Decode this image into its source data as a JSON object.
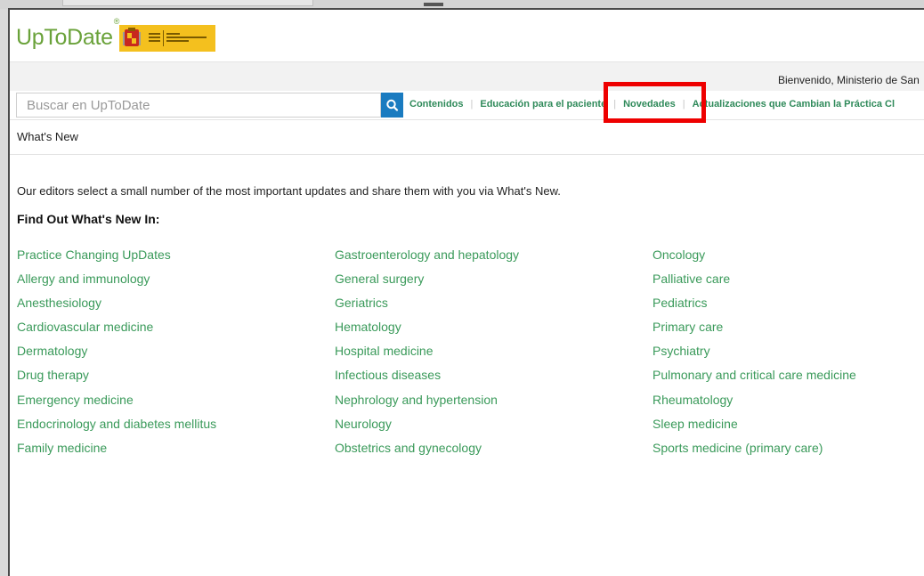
{
  "brand": {
    "logo_text": "UpToDate",
    "registered": "®"
  },
  "header": {
    "welcome": "Bienvenido, Ministerio de San"
  },
  "search": {
    "placeholder": "Buscar en UpToDate",
    "value": ""
  },
  "nav": {
    "items": [
      {
        "label": "Contenidos"
      },
      {
        "label": "Educación para el paciente"
      },
      {
        "label": "Novedades"
      },
      {
        "label": "Actualizaciones que Cambian la Práctica Cl"
      }
    ]
  },
  "breadcrumb": "What's New",
  "content": {
    "intro": "Our editors select a small number of the most important updates and share them with you via What's New.",
    "heading": "Find Out What's New In:",
    "columns": [
      [
        "Practice Changing UpDates",
        "Allergy and immunology",
        "Anesthesiology",
        "Cardiovascular medicine",
        "Dermatology",
        "Drug therapy",
        "Emergency medicine",
        "Endocrinology and diabetes mellitus",
        "Family medicine"
      ],
      [
        "Gastroenterology and hepatology",
        "General surgery",
        "Geriatrics",
        "Hematology",
        "Hospital medicine",
        "Infectious diseases",
        "Nephrology and hypertension",
        "Neurology",
        "Obstetrics and gynecology"
      ],
      [
        "Oncology",
        "Palliative care",
        "Pediatrics",
        "Primary care",
        "Psychiatry",
        "Pulmonary and critical care medicine",
        "Rheumatology",
        "Sleep medicine",
        "Sports medicine (primary care)"
      ]
    ]
  },
  "colors": {
    "brand_green": "#6aa23a",
    "link_green": "#3a9a5a",
    "nav_green": "#2f8a5a",
    "search_blue": "#1a7bc0",
    "highlight_red": "#ee0000"
  },
  "icons": {
    "search": "search-icon",
    "gov_logo": "spain-government-logo"
  }
}
